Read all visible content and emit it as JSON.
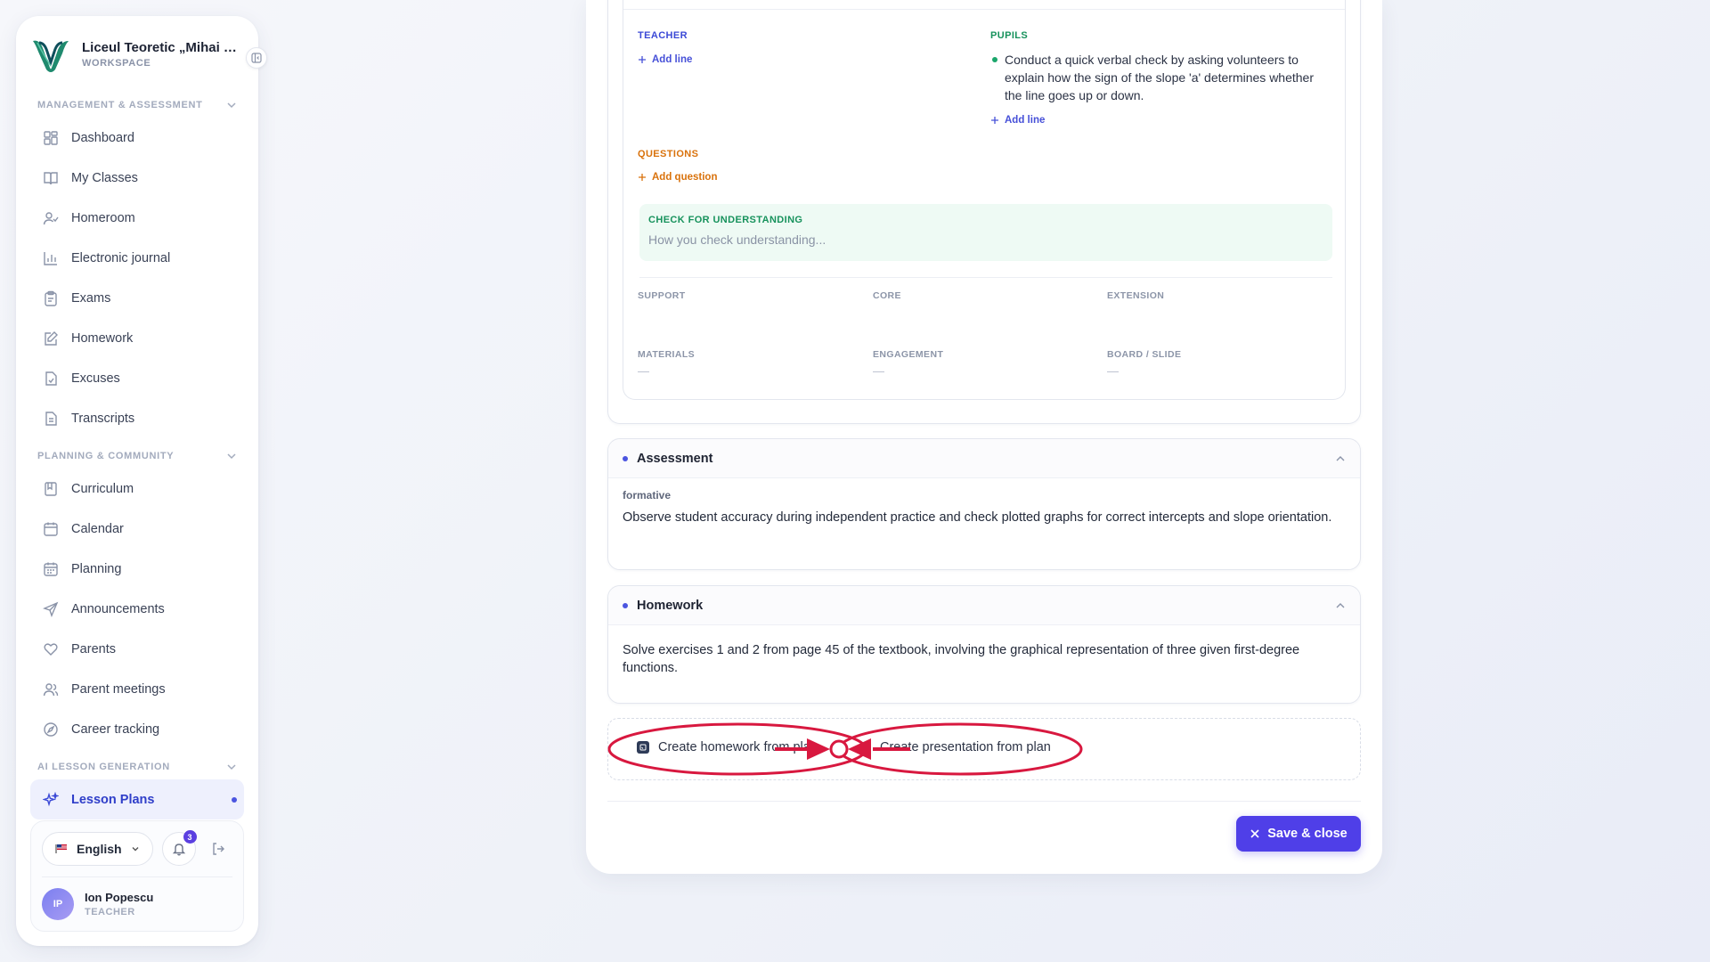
{
  "sidebar": {
    "brand": {
      "name": "Liceul Teoretic „Mihai Eminescu”",
      "sub": "WORKSPACE"
    },
    "sections": [
      {
        "title": "MANAGEMENT & ASSESSMENT",
        "items": [
          {
            "label": "Dashboard",
            "icon": "dashboard-icon"
          },
          {
            "label": "My Classes",
            "icon": "book-open-icon"
          },
          {
            "label": "Homeroom",
            "icon": "user-check-icon"
          },
          {
            "label": "Electronic journal",
            "icon": "bar-chart-icon"
          },
          {
            "label": "Exams",
            "icon": "clipboard-icon"
          },
          {
            "label": "Homework",
            "icon": "edit-icon"
          },
          {
            "label": "Excuses",
            "icon": "file-check-icon"
          },
          {
            "label": "Transcripts",
            "icon": "file-text-icon"
          }
        ]
      },
      {
        "title": "PLANNING & COMMUNITY",
        "items": [
          {
            "label": "Curriculum",
            "icon": "book-icon"
          },
          {
            "label": "Calendar",
            "icon": "calendar-icon"
          },
          {
            "label": "Planning",
            "icon": "calendar-grid-icon"
          },
          {
            "label": "Announcements",
            "icon": "send-icon"
          },
          {
            "label": "Parents",
            "icon": "heart-icon"
          },
          {
            "label": "Parent meetings",
            "icon": "users-icon"
          },
          {
            "label": "Career tracking",
            "icon": "compass-icon"
          }
        ]
      },
      {
        "title": "AI LESSON GENERATION",
        "items": [
          {
            "label": "Lesson Plans",
            "icon": "sparkles-icon",
            "active": true
          }
        ]
      }
    ],
    "footer": {
      "language": "English",
      "notifications_count": "3",
      "user_name": "Ion Popescu",
      "user_initials": "IP",
      "user_role": "TEACHER"
    }
  },
  "lesson": {
    "teacher_label": "TEACHER",
    "pupils_label": "PUPILS",
    "add_line": "Add line",
    "pupils_lines": [
      "Conduct a quick verbal check by asking volunteers to explain how the sign of the slope 'a' determines whether the line goes up or down."
    ],
    "questions_label": "QUESTIONS",
    "add_question": "Add question",
    "cfu_label": "CHECK FOR UNDERSTANDING",
    "cfu_placeholder": "How you check understanding...",
    "diff": {
      "support": "SUPPORT",
      "core": "CORE",
      "extension": "EXTENSION"
    },
    "resources": {
      "materials": "MATERIALS",
      "engagement": "ENGAGEMENT",
      "board": "BOARD / SLIDE",
      "empty": "—"
    }
  },
  "assessment": {
    "title": "Assessment",
    "type": "formative",
    "text": "Observe student accuracy during independent practice and check plotted graphs for correct intercepts and slope orientation."
  },
  "homework": {
    "title": "Homework",
    "text": "Solve exercises 1 and 2 from page 45 of the textbook, involving the graphical representation of three given first-degree functions."
  },
  "actions": {
    "create_homework": "Create homework from plan",
    "create_presentation": "Create presentation from plan",
    "save_close": "Save & close"
  },
  "colors": {
    "accent": "#4f3fe8",
    "annotation": "#d8183f"
  }
}
